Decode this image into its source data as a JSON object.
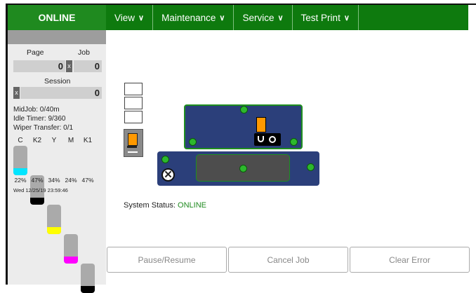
{
  "status_tab": "ONLINE",
  "menu": [
    {
      "label": "View"
    },
    {
      "label": "Maintenance"
    },
    {
      "label": "Service"
    },
    {
      "label": "Test Print"
    }
  ],
  "counters": {
    "page_label": "Page",
    "job_label": "Job",
    "page_value": "0",
    "job_value": "0",
    "session_label": "Session",
    "session_value": "0",
    "reset_glyph": "x"
  },
  "info": {
    "midjob": "MidJob: 0/40m",
    "idle_timer": "Idle Timer: 9/360",
    "wiper_transfer": "Wiper Transfer: 0/1"
  },
  "inks": [
    {
      "name": "C",
      "percent": "22%",
      "level": 0.22,
      "color": "#00e5ff"
    },
    {
      "name": "K2",
      "percent": "47%",
      "level": 0.47,
      "color": "#000000"
    },
    {
      "name": "Y",
      "percent": "34%",
      "level": 0.34,
      "color": "#ffff00"
    },
    {
      "name": "M",
      "percent": "24%",
      "level": 0.24,
      "color": "#ff00ff"
    },
    {
      "name": "K1",
      "percent": "47%",
      "level": 0.47,
      "color": "#000000"
    }
  ],
  "datetime": "Wed 12/25/19 23:59:46",
  "system_status": {
    "label": "System Status:",
    "value": "ONLINE"
  },
  "buttons": {
    "pause": "Pause/Resume",
    "cancel": "Cancel Job",
    "clear": "Clear Error"
  },
  "colors": {
    "online_green": "#1f8a1f",
    "menu_green": "#0e7a0e",
    "carriage_blue": "#2b3f7a",
    "head_orange": "#ff9900"
  }
}
